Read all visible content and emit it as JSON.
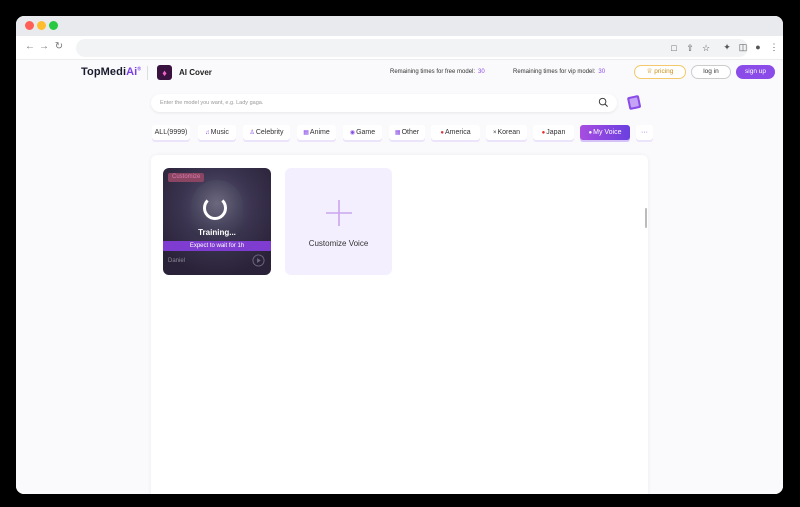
{
  "header": {
    "logo_text": "TopMedi",
    "logo_ai": "Ai",
    "logo_reg": "®",
    "app_name": "AI Cover",
    "free_label": "Remaining times for free model:",
    "free_count": "30",
    "vip_label": "Remaining times for vip model:",
    "vip_count": "30",
    "pricing_label": "pricing",
    "login_label": "log in",
    "signup_label": "sign up"
  },
  "search": {
    "placeholder": "Enter the model you want, e.g. Lady gaga."
  },
  "categories": [
    {
      "label": "ALL(9999)",
      "icon": ""
    },
    {
      "label": "Music",
      "icon": "music-icon"
    },
    {
      "label": "Celebrity",
      "icon": "person-icon"
    },
    {
      "label": "Anime",
      "icon": "anime-icon"
    },
    {
      "label": "Game",
      "icon": "gamepad-icon"
    },
    {
      "label": "Other",
      "icon": "grid-icon"
    },
    {
      "label": "America",
      "icon": "us-flag-icon"
    },
    {
      "label": "Korean",
      "icon": "kr-flag-icon"
    },
    {
      "label": "Japan",
      "icon": "jp-flag-icon"
    },
    {
      "label": "My Voice",
      "icon": "mic-icon"
    },
    {
      "label": "···",
      "icon": ""
    }
  ],
  "active_category": "My Voice",
  "cards": {
    "training": {
      "badge": "Customize",
      "status": "Training...",
      "wait": "Expect to wait for 1h",
      "name": "Daniel"
    },
    "add": {
      "label": "Customize Voice"
    }
  },
  "colors": {
    "accent": "#8a4be8",
    "pricing": "#f3c96b"
  }
}
